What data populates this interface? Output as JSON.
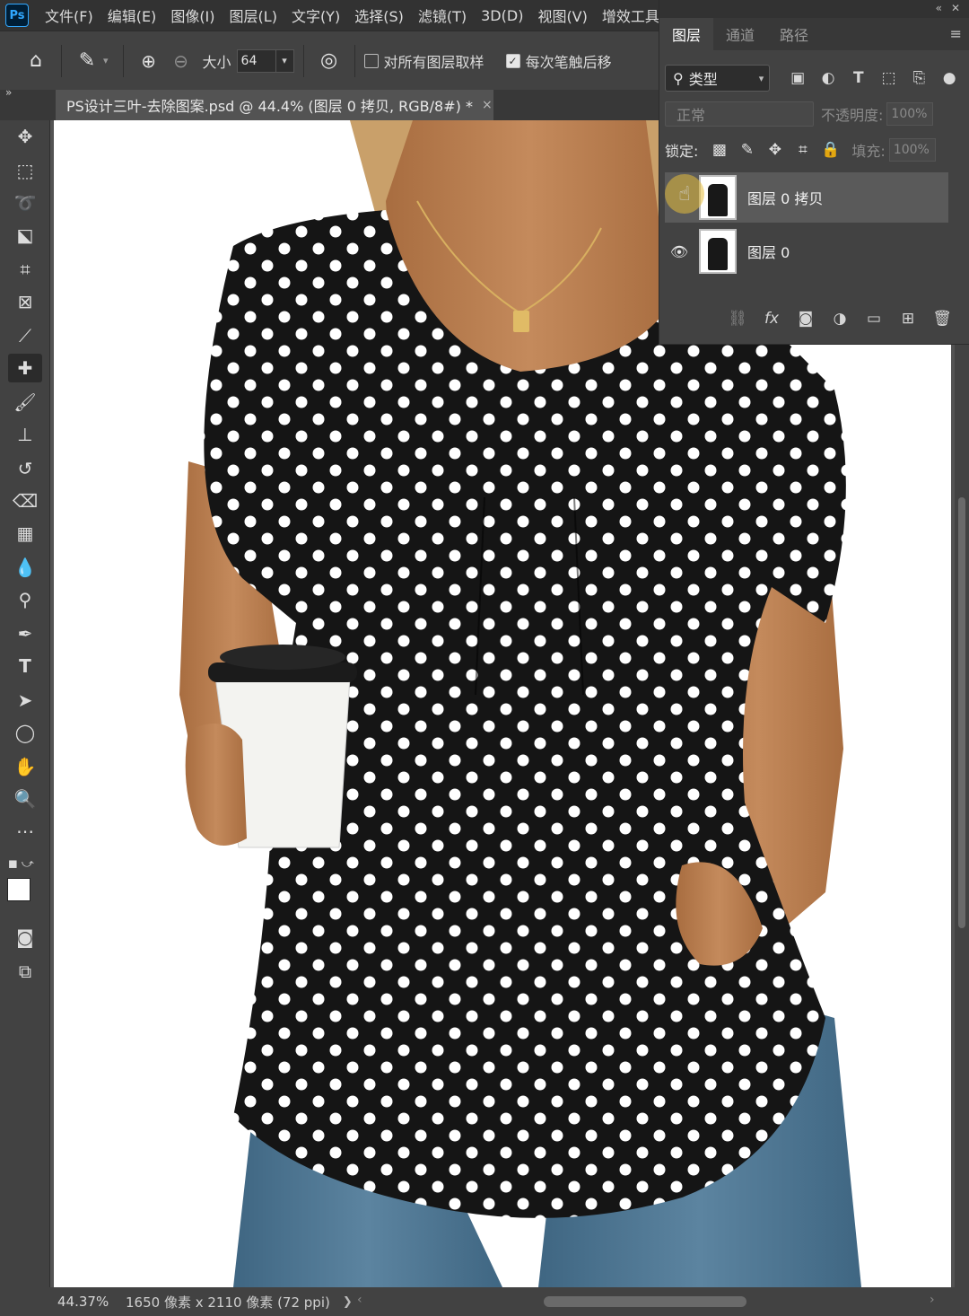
{
  "app": {
    "logo": "Ps"
  },
  "menu": [
    "文件(F)",
    "编辑(E)",
    "图像(I)",
    "图层(L)",
    "文字(Y)",
    "选择(S)",
    "滤镜(T)",
    "3D(D)",
    "视图(V)",
    "增效工具"
  ],
  "options": {
    "size_label": "大小",
    "size_value": "64",
    "sample_all_layers": "对所有图层取样",
    "sample_all_checked": false,
    "each_stroke": "每次笔触后移",
    "each_stroke_checked": true
  },
  "document": {
    "tab_title": "PS设计三叶-去除图案.psd @ 44.4% (图层 0 拷贝, RGB/8#) *",
    "close": "×"
  },
  "status": {
    "zoom": "44.37%",
    "doc_info": "1650 像素 x 2110 像素 (72 ppi)",
    "arrow": "❯"
  },
  "layers_panel": {
    "tabs": [
      "图层",
      "通道",
      "路径"
    ],
    "active_tab": 0,
    "filter_kind": "类型",
    "blend_mode": "正常",
    "opacity_label": "不透明度:",
    "opacity_value": "100%",
    "lock_label": "锁定:",
    "fill_label": "填充:",
    "fill_value": "100%",
    "layers": [
      {
        "name": "图层 0 拷贝",
        "selected": true,
        "visible": true
      },
      {
        "name": "图层 0",
        "selected": false,
        "visible": true
      }
    ]
  },
  "colors": {
    "shirt": "#151515",
    "dot": "#ffffff",
    "skin": "#b87d4f",
    "denim": "#4e7590",
    "hair": "#c9a06a",
    "panel_bg": "#424242",
    "app_bg": "#535353"
  }
}
